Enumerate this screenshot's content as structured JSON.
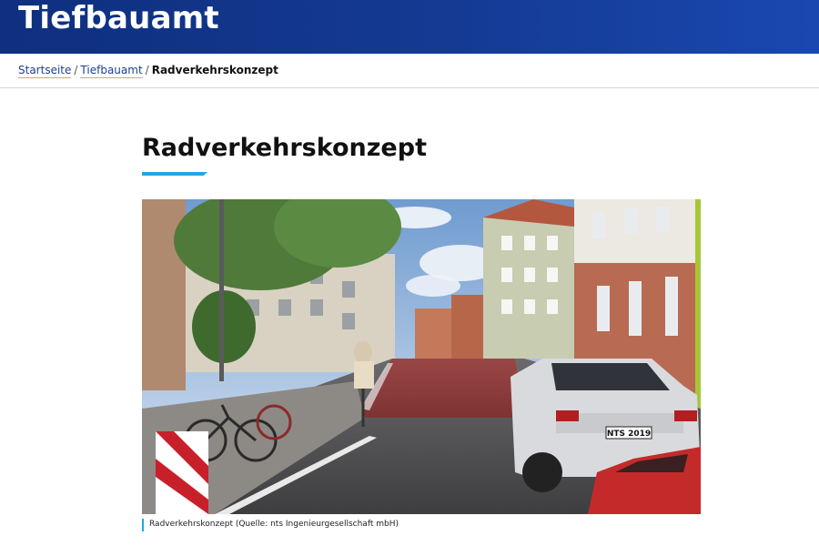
{
  "header": {
    "site_title": "Tiefbauamt"
  },
  "breadcrumb": {
    "items": [
      {
        "label": "Startseite"
      },
      {
        "label": "Tiefbauamt"
      }
    ],
    "separator": "/",
    "current": "Radverkehrskonzept"
  },
  "main": {
    "title": "Radverkehrskonzept",
    "image": {
      "license_plate": "NTS 2019",
      "caption": "Radverkehrskonzept (Quelle: nts Ingenieurgesellschaft mbH)"
    }
  },
  "colors": {
    "header_blue": "#143a93",
    "accent_cyan": "#1ea7e8",
    "link_blue": "#1d3f8f",
    "link_underline": "#e8a24a",
    "bike_lane_red": "#8e3a3a"
  }
}
